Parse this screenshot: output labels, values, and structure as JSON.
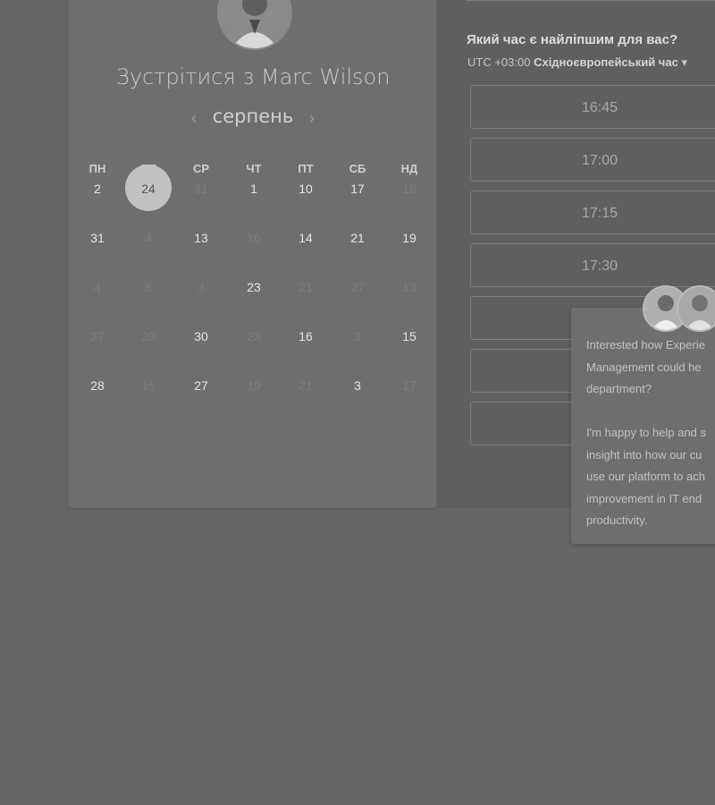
{
  "meeting": {
    "title": "Зустрітися з Marc Wilson"
  },
  "calendar": {
    "month": "серпень",
    "prev_arrow": "‹",
    "next_arrow": "›",
    "weekdays": [
      "ПН",
      "ВТ",
      "СР",
      "ЧТ",
      "ПТ",
      "СБ",
      "НД"
    ],
    "selected_day": "24",
    "rows": [
      [
        {
          "d": "2",
          "on": true
        },
        {
          "d": "24",
          "on": true,
          "sel": true
        },
        {
          "d": "31",
          "on": false
        },
        {
          "d": "1",
          "on": true
        },
        {
          "d": "10",
          "on": true
        },
        {
          "d": "17",
          "on": true
        },
        {
          "d": "19",
          "on": false
        }
      ],
      [
        {
          "d": "31",
          "on": true
        },
        {
          "d": "4",
          "on": false
        },
        {
          "d": "13",
          "on": true
        },
        {
          "d": "16",
          "on": false
        },
        {
          "d": "14",
          "on": true
        },
        {
          "d": "21",
          "on": true
        },
        {
          "d": "19",
          "on": true
        }
      ],
      [
        {
          "d": "4",
          "on": false
        },
        {
          "d": "8",
          "on": false
        },
        {
          "d": "3",
          "on": false
        },
        {
          "d": "23",
          "on": true
        },
        {
          "d": "21",
          "on": false
        },
        {
          "d": "27",
          "on": false
        },
        {
          "d": "13",
          "on": false
        }
      ],
      [
        {
          "d": "27",
          "on": false
        },
        {
          "d": "20",
          "on": false
        },
        {
          "d": "30",
          "on": true
        },
        {
          "d": "23",
          "on": false
        },
        {
          "d": "16",
          "on": true
        },
        {
          "d": "3",
          "on": false
        },
        {
          "d": "15",
          "on": true
        }
      ],
      [
        {
          "d": "28",
          "on": true
        },
        {
          "d": "15",
          "on": false
        },
        {
          "d": "27",
          "on": true
        },
        {
          "d": "19",
          "on": false
        },
        {
          "d": "21",
          "on": false
        },
        {
          "d": "3",
          "on": true
        },
        {
          "d": "17",
          "on": false
        }
      ]
    ]
  },
  "times": {
    "question": "Який час є найліпшим для вас?",
    "tz_offset": "UTC +03:00",
    "tz_name": "Східноєвропейський час",
    "slots": [
      "16:45",
      "17:00",
      "17:15",
      "17:30",
      "",
      "",
      ""
    ]
  },
  "chat": {
    "message": "Interested how Experie\nManagement could he\ndepartment?\n\nI'm happy to help and s\ninsight into how our cu\nuse our platform to ach\nimprovement in IT end\nproductivity."
  }
}
